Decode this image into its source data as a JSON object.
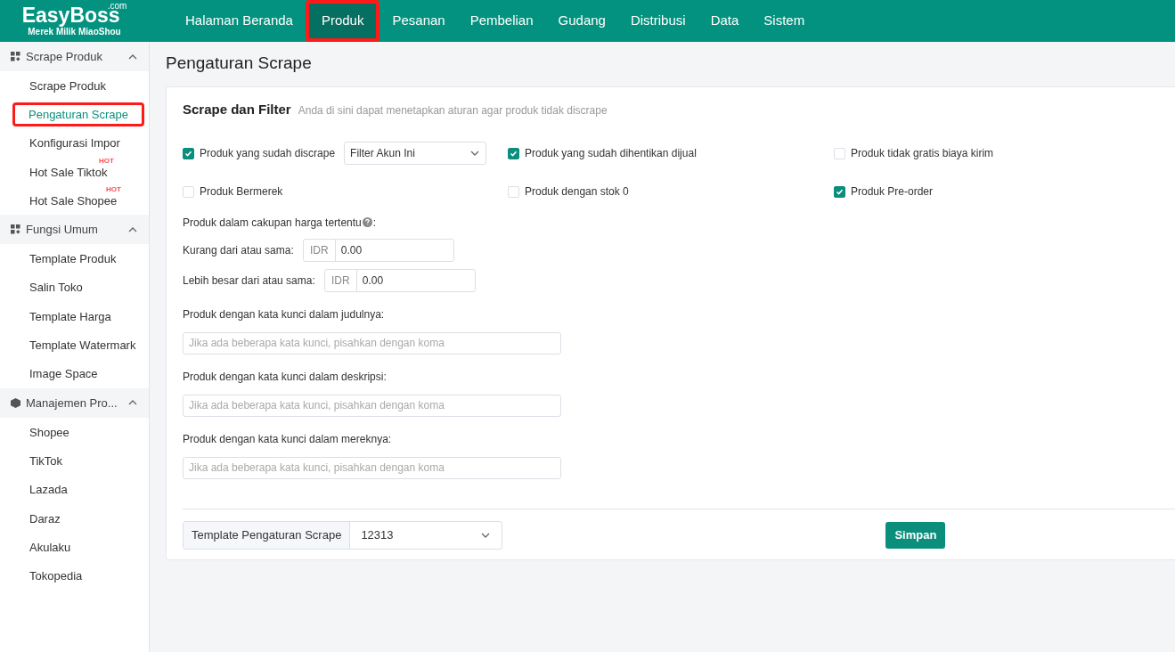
{
  "header": {
    "logo": "EasyBoss",
    "logo_suffix": ".com",
    "tagline": "Merek Milik MiaoShou",
    "nav": [
      {
        "label": "Halaman Beranda",
        "selected": false,
        "annotated": false
      },
      {
        "label": "Produk",
        "selected": true,
        "annotated": true
      },
      {
        "label": "Pesanan",
        "selected": false,
        "annotated": false
      },
      {
        "label": "Pembelian",
        "selected": false,
        "annotated": false
      },
      {
        "label": "Gudang",
        "selected": false,
        "annotated": false
      },
      {
        "label": "Distribusi",
        "selected": false,
        "annotated": false
      },
      {
        "label": "Data",
        "selected": false,
        "annotated": false
      },
      {
        "label": "Sistem",
        "selected": false,
        "annotated": false
      }
    ]
  },
  "sidebar": {
    "groups": [
      {
        "label": "Scrape Produk",
        "kind": "grid",
        "expanded": true,
        "items": [
          {
            "label": "Scrape Produk",
            "selected": false,
            "annotated": false
          },
          {
            "label": "Pengaturan Scrape",
            "selected": true,
            "annotated": true
          },
          {
            "label": "Konfigurasi Impor",
            "selected": false,
            "annotated": false
          },
          {
            "label": "Hot Sale Tiktok",
            "badge": "HOT",
            "selected": false,
            "annotated": false
          },
          {
            "label": "Hot Sale Shopee",
            "badge": "HOT",
            "selected": false,
            "annotated": false
          }
        ]
      },
      {
        "label": "Fungsi Umum",
        "kind": "grid",
        "expanded": true,
        "items": [
          {
            "label": "Template Produk",
            "selected": false,
            "annotated": false
          },
          {
            "label": "Salin Toko",
            "selected": false,
            "annotated": false
          },
          {
            "label": "Template Harga",
            "selected": false,
            "annotated": false
          },
          {
            "label": "Template Watermark",
            "selected": false,
            "annotated": false
          },
          {
            "label": "Image Space",
            "selected": false,
            "annotated": false
          }
        ]
      },
      {
        "label": "Manajemen Pro...",
        "kind": "box",
        "expanded": true,
        "items": [
          {
            "label": "Shopee",
            "selected": false,
            "annotated": false
          },
          {
            "label": "TikTok",
            "selected": false,
            "annotated": false
          },
          {
            "label": "Lazada",
            "selected": false,
            "annotated": false
          },
          {
            "label": "Daraz",
            "selected": false,
            "annotated": false
          },
          {
            "label": "Akulaku",
            "selected": false,
            "annotated": false
          },
          {
            "label": "Tokopedia",
            "selected": false,
            "annotated": false
          }
        ]
      }
    ]
  },
  "page_title": "Pengaturan Scrape",
  "card": {
    "title": "Scrape dan Filter",
    "subtitle": "Anda di sini dapat menetapkan aturan agar produk tidak discrape",
    "checkboxes": [
      {
        "label": "Produk yang sudah discrape",
        "checked": true,
        "select": "Filter Akun Ini"
      },
      {
        "label": "Produk yang sudah dihentikan dijual",
        "checked": true
      },
      {
        "label": "Produk tidak gratis biaya kirim",
        "checked": false
      },
      {
        "label": "Produk Bermerek",
        "checked": false
      },
      {
        "label": "Produk dengan stok 0",
        "checked": false
      },
      {
        "label": "Produk Pre-order",
        "checked": true
      }
    ],
    "price_label": "Produk dalam cakupan harga tertentu",
    "price_label_suffix": ":",
    "price_fields": [
      {
        "label": "Kurang dari atau sama:",
        "currency": "IDR",
        "value": "0.00"
      },
      {
        "label": "Lebih besar dari atau sama:",
        "currency": "IDR",
        "value": "0.00"
      }
    ],
    "keyword_fields": [
      {
        "label": "Produk dengan kata kunci dalam judulnya:",
        "placeholder": "Jika ada beberapa kata kunci, pisahkan dengan koma"
      },
      {
        "label": "Produk dengan kata kunci dalam deskripsi:",
        "placeholder": "Jika ada beberapa kata kunci, pisahkan dengan koma"
      },
      {
        "label": "Produk dengan kata kunci dalam mereknya:",
        "placeholder": "Jika ada beberapa kata kunci, pisahkan dengan koma"
      }
    ],
    "template": {
      "label": "Template Pengaturan Scrape",
      "value": "12313"
    },
    "save_button": "Simpan"
  }
}
